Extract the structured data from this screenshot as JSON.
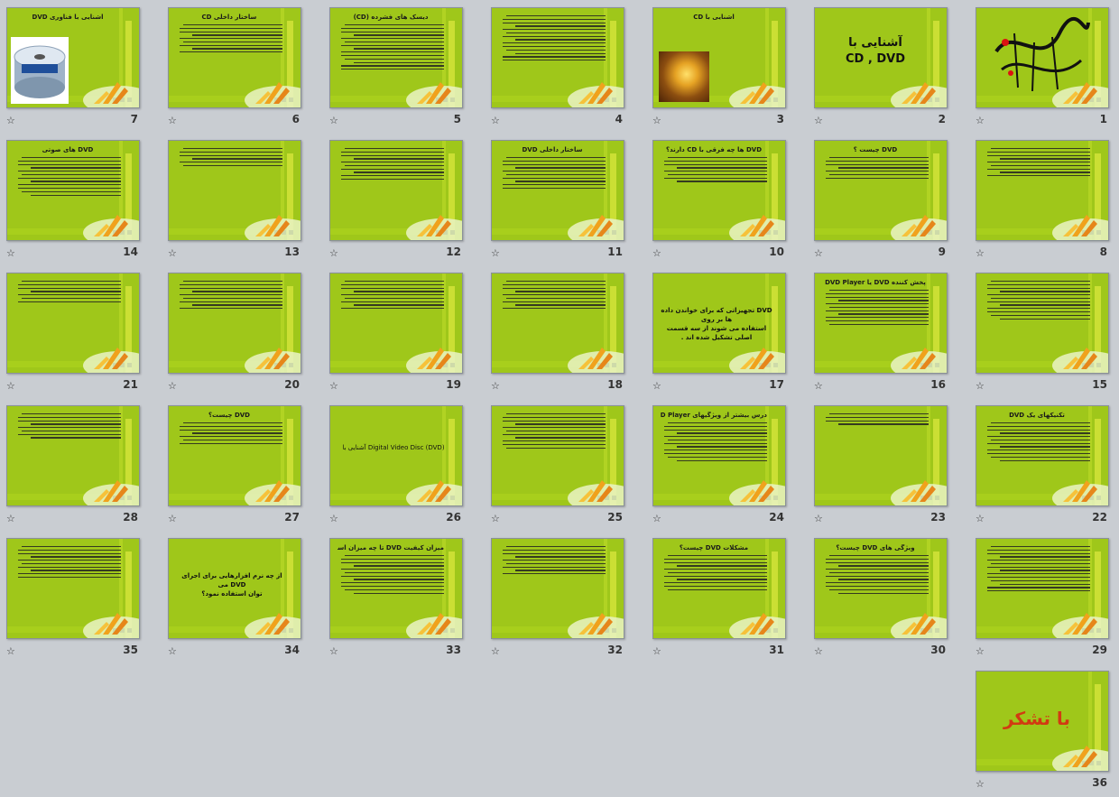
{
  "view": "slide-sorter",
  "slides": [
    {
      "number": "1",
      "title": "",
      "big": "",
      "lines": 0,
      "kind": "calligraphy"
    },
    {
      "number": "2",
      "title": "",
      "big": "آشنایی با\nCD , DVD",
      "lines": 0,
      "kind": "title"
    },
    {
      "number": "3",
      "title": "آشنایی با CD",
      "big": "",
      "lines": 0,
      "kind": "cd"
    },
    {
      "number": "4",
      "title": "",
      "big": "",
      "lines": 14,
      "kind": "text"
    },
    {
      "number": "5",
      "title": "دیسک های فشرده (CD)",
      "big": "",
      "lines": 14,
      "kind": "text"
    },
    {
      "number": "6",
      "title": "ساختار داخلی CD",
      "big": "",
      "lines": 9,
      "kind": "text"
    },
    {
      "number": "7",
      "title": "آشنایی با فناوری DVD",
      "big": "",
      "lines": 0,
      "kind": "dvd"
    },
    {
      "number": "8",
      "title": "",
      "big": "",
      "lines": 9,
      "kind": "text"
    },
    {
      "number": "9",
      "title": "DVD چیست ؟",
      "big": "",
      "lines": 7,
      "kind": "text"
    },
    {
      "number": "10",
      "title": "DVD ها چه فرقی با CD دارند؟",
      "big": "",
      "lines": 8,
      "kind": "text"
    },
    {
      "number": "11",
      "title": "ساختار داخلی DVD",
      "big": "",
      "lines": 10,
      "kind": "text"
    },
    {
      "number": "12",
      "title": "",
      "big": "",
      "lines": 10,
      "kind": "text"
    },
    {
      "number": "13",
      "title": "",
      "big": "",
      "lines": 6,
      "kind": "text"
    },
    {
      "number": "14",
      "title": "DVD های صوتی",
      "big": "",
      "lines": 12,
      "kind": "text"
    },
    {
      "number": "15",
      "title": "",
      "big": "",
      "lines": 12,
      "kind": "text"
    },
    {
      "number": "16",
      "title": "پخش کننده DVD یا DVD Player",
      "big": "",
      "lines": 11,
      "kind": "text"
    },
    {
      "number": "17",
      "title": "",
      "big": "DVD تجهیزاتی که برای خواندن داده ها بر روی\nاستفاده می شوند از سه قسمت اصلی تشکیل شده اند .",
      "lines": 0,
      "kind": "statement"
    },
    {
      "number": "18",
      "title": "",
      "big": "",
      "lines": 9,
      "kind": "text"
    },
    {
      "number": "19",
      "title": "",
      "big": "",
      "lines": 9,
      "kind": "text"
    },
    {
      "number": "20",
      "title": "",
      "big": "",
      "lines": 9,
      "kind": "text"
    },
    {
      "number": "21",
      "title": "",
      "big": "",
      "lines": 7,
      "kind": "text"
    },
    {
      "number": "22",
      "title": "تکنیکهای یک DVD",
      "big": "",
      "lines": 12,
      "kind": "text"
    },
    {
      "number": "23",
      "title": "",
      "big": "",
      "lines": 4,
      "kind": "text"
    },
    {
      "number": "24",
      "title": "درس بیشتر از ویژگیهای DVD Player ها",
      "big": "",
      "lines": 12,
      "kind": "text"
    },
    {
      "number": "25",
      "title": "",
      "big": "",
      "lines": 11,
      "kind": "text"
    },
    {
      "number": "26",
      "title": "",
      "big": "آشنایی با Digital Video Disc (DVD)",
      "lines": 0,
      "kind": "statement-small"
    },
    {
      "number": "27",
      "title": "DVD چیست؟",
      "big": "",
      "lines": 7,
      "kind": "text"
    },
    {
      "number": "28",
      "title": "",
      "big": "",
      "lines": 8,
      "kind": "text"
    },
    {
      "number": "29",
      "title": "",
      "big": "",
      "lines": 14,
      "kind": "text"
    },
    {
      "number": "30",
      "title": "ویژگی های DVD چیست؟",
      "big": "",
      "lines": 12,
      "kind": "text"
    },
    {
      "number": "31",
      "title": "مشکلات DVD چیست؟",
      "big": "",
      "lines": 11,
      "kind": "text"
    },
    {
      "number": "32",
      "title": "",
      "big": "",
      "lines": 9,
      "kind": "text"
    },
    {
      "number": "33",
      "title": "میزان کیفیت DVD تا چه میزان است؟",
      "big": "",
      "lines": 12,
      "kind": "text"
    },
    {
      "number": "34",
      "title": "",
      "big": "از چه نرم افزارهایی برای اجرای DVD می\nتوان استفاده نمود؟",
      "lines": 0,
      "kind": "statement"
    },
    {
      "number": "35",
      "title": "",
      "big": "",
      "lines": 10,
      "kind": "text"
    },
    {
      "number": "36",
      "title": "",
      "big": "با تشکر",
      "lines": 0,
      "kind": "thanks"
    }
  ],
  "star_glyph": "☆",
  "colors": {
    "slide_bg": "#9fc71a",
    "workspace": "#c9cdd2",
    "thanks": "#d23a12"
  }
}
